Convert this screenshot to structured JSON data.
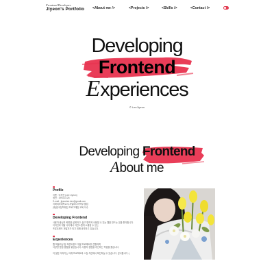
{
  "header": {
    "brand_sub": "Frontend Developer",
    "brand_name": "Jiyeon's Portfolio",
    "nav": [
      "<About me />",
      "<Projects />",
      "<Skills />",
      "<Contact />"
    ]
  },
  "hero": {
    "line1": "Developing",
    "line2": "Frontend",
    "line3_cap": "E",
    "line3_rest": "xperiences",
    "credit": "© LeeJiyeon"
  },
  "about": {
    "heading_plain": "Developing ",
    "heading_bold": "Frontend",
    "heading2_cap": "A",
    "heading2_rest": "bout me",
    "sections": [
      {
        "title": "Profile",
        "lines": [
          "이름 : 이지연 (Lee Jiyeon)",
          "생년 : 1993.03.26",
          "E-mail : jiyeonlee.dev@gmail.com",
          "이화여자대학교 디지털미디어학부 졸업",
          "(재)한국장학재단 프로그래밍 교육 이수"
        ]
      },
      {
        "title": "Developing Frontend",
        "lines": [
          "사용자 중심의 화면을 설계하고, 쉽고 편하게 사용할 수 있는 웹을 만드는 것을 좋아합니다.",
          "디자인과 개발 사이에서 자연스럽게 소통할 수 있는",
          "프론트엔드 개발자가 되기 위해 공부하고 있습니다."
        ]
      },
      {
        "title": "Experiences",
        "lines": [
          "웹 퍼블리싱 및 프론트엔드 개발 프로젝트를 진행하며",
          "다양한 협업 경험을 쌓았습니다. 사용자 경험을 개선하는 작업을 즐깁니다."
        ]
      }
    ],
    "footnote": "더 많은 이야기는 아래 프로젝트와 스킬 섹션에서 확인하실 수 있습니다. 감사합니다 :)"
  },
  "colors": {
    "accent": "#e23c52",
    "brush": "#e8334f",
    "text": "#111111"
  },
  "icons": [
    "theme-toggle-icon"
  ]
}
